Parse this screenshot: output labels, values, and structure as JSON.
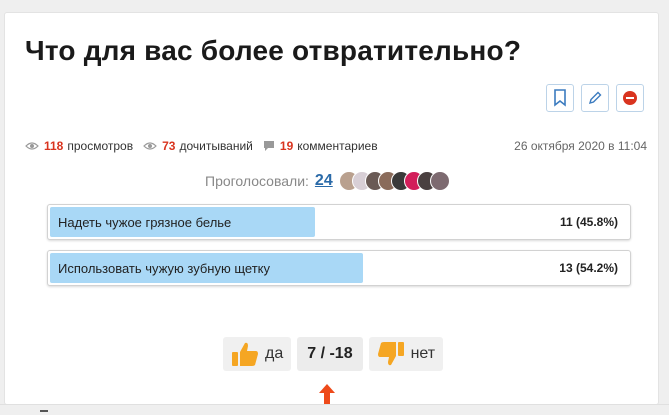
{
  "title": "Что для вас более отвратительно?",
  "toolbar": {
    "bookmark_icon": "bookmark-icon",
    "edit_icon": "pencil-icon",
    "block_icon": "no-entry-icon"
  },
  "stats": {
    "views_count": "118",
    "views_label": "просмотров",
    "reads_count": "73",
    "reads_label": "дочитываний",
    "comments_count": "19",
    "comments_label": "комментариев",
    "date": "26 октября 2020 в 11:04"
  },
  "voters": {
    "label": "Проголосовали:",
    "count": "24",
    "avatar_colors": [
      "#b9a08e",
      "#d8cfd6",
      "#6a5a55",
      "#8a6b5a",
      "#3a3a3a",
      "#d21e5a",
      "#4a4040",
      "#7d6a70"
    ]
  },
  "poll": {
    "options": [
      {
        "label": "Надеть чужое грязное белье",
        "result": "11 (45.8%)",
        "fraction": 0.458
      },
      {
        "label": "Использовать чужую зубную щетку",
        "result": "13 (54.2%)",
        "fraction": 0.542
      }
    ]
  },
  "rating": {
    "yes_label": "да",
    "score": "7 / -18",
    "no_label": "нет"
  },
  "colors": {
    "accent_red": "#d9341f",
    "poll_fill": "#a9d8f6",
    "thumb_orange": "#f5a623",
    "link_blue": "#2a6aa8"
  }
}
